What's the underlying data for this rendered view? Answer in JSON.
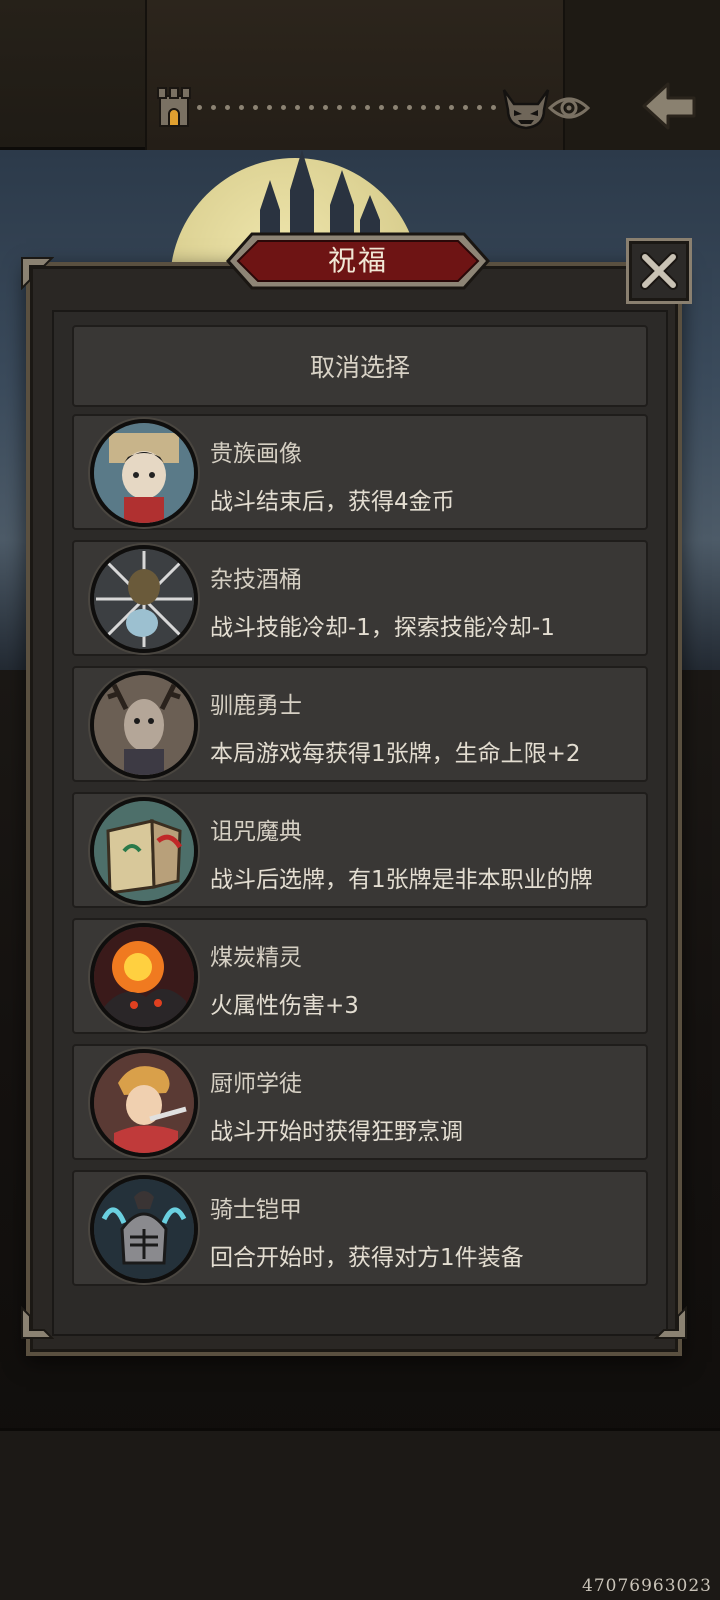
{
  "header": {
    "castle_icon": "castle-icon",
    "boss_icon": "horned-demon-icon",
    "eye_icon": "eye-icon",
    "back_icon": "back-arrow-icon"
  },
  "dialog": {
    "title": "祝福",
    "close_icon": "close-x-icon",
    "cancel_label": "取消选择",
    "items": [
      {
        "name": "贵族画像",
        "desc": "战斗结束后，获得4金币",
        "icon": "noble-portrait-icon"
      },
      {
        "name": "杂技酒桶",
        "desc": "战斗技能冷却-1，探索技能冷却-1",
        "icon": "acrobat-barrel-icon"
      },
      {
        "name": "驯鹿勇士",
        "desc": "本局游戏每获得1张牌，生命上限+2",
        "icon": "reindeer-warrior-icon"
      },
      {
        "name": "诅咒魔典",
        "desc": "战斗后选牌，有1张牌是非本职业的牌",
        "icon": "cursed-grimoire-icon"
      },
      {
        "name": "煤炭精灵",
        "desc": "火属性伤害+3",
        "icon": "coal-spirit-icon"
      },
      {
        "name": "厨师学徒",
        "desc": "战斗开始时获得狂野烹调",
        "icon": "chef-apprentice-icon"
      },
      {
        "name": "骑士铠甲",
        "desc": "回合开始时，获得对方1件装备",
        "icon": "knight-armor-icon"
      }
    ]
  },
  "footer": {
    "watermark": "47076963023"
  }
}
